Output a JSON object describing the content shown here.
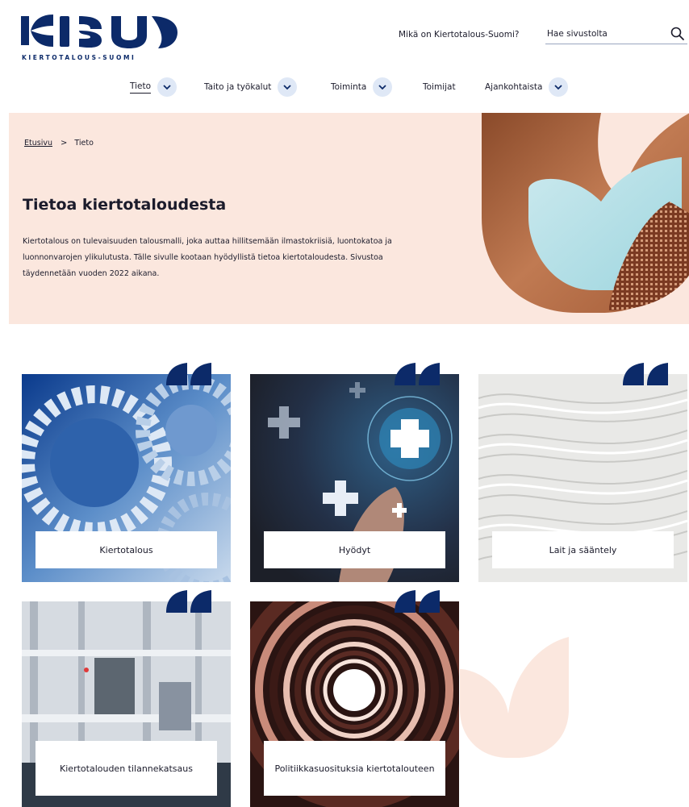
{
  "header": {
    "logo_text": "KIERTOTALOUS-SUOMI",
    "top_link": "Mikä on Kiertotalous-Suomi?",
    "search": {
      "placeholder": "Hae sivustolta"
    }
  },
  "nav": {
    "items": [
      {
        "label": "Tieto",
        "active": true,
        "has_dropdown": true
      },
      {
        "label": "Taito ja työkalut",
        "has_dropdown": true
      },
      {
        "label": "Toiminta",
        "has_dropdown": true
      },
      {
        "label": "Toimijat",
        "has_dropdown": false
      },
      {
        "label": "Ajankohtaista",
        "has_dropdown": true
      }
    ]
  },
  "breadcrumb": {
    "home": "Etusivu",
    "separator": ">",
    "current": "Tieto"
  },
  "hero": {
    "title": "Tietoa kiertotaloudesta",
    "text": "Kiertotalous on tulevaisuuden talousmalli, joka auttaa hillitsemään ilmastokriisiä, luontokatoa ja luonnonvarojen ylikulutusta. Tälle sivulle kootaan hyödyllistä tietoa kiertotaloudesta. Sivustoa täydennetään vuoden 2022 aikana."
  },
  "cards": [
    {
      "label": "Kiertotalous"
    },
    {
      "label": "Hyödyt"
    },
    {
      "label": "Lait ja sääntely"
    },
    {
      "label": "Kiertotalouden tilannekatsaus"
    },
    {
      "label": "Politiikkasuosituksia kiertotalouteen"
    }
  ],
  "colors": {
    "brand_navy": "#0c2a69",
    "hero_bg": "#fbe7de",
    "chevron_bg": "#dfe8f6",
    "text": "#1b1b2b"
  }
}
